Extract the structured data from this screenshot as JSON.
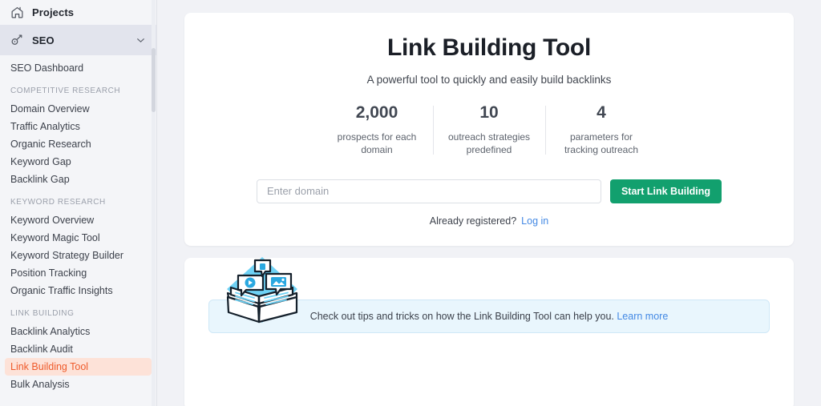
{
  "sidebar": {
    "projects": {
      "label": "Projects",
      "icon": "home-icon"
    },
    "seo": {
      "label": "SEO",
      "icon": "seo-magnifier-icon",
      "chevron": "chevron-down-icon"
    },
    "dashboard": {
      "label": "SEO Dashboard"
    },
    "sections": [
      {
        "title": "COMPETITIVE RESEARCH",
        "items": [
          {
            "label": "Domain Overview",
            "active": false
          },
          {
            "label": "Traffic Analytics",
            "active": false
          },
          {
            "label": "Organic Research",
            "active": false
          },
          {
            "label": "Keyword Gap",
            "active": false
          },
          {
            "label": "Backlink Gap",
            "active": false
          }
        ]
      },
      {
        "title": "KEYWORD RESEARCH",
        "items": [
          {
            "label": "Keyword Overview",
            "active": false
          },
          {
            "label": "Keyword Magic Tool",
            "active": false
          },
          {
            "label": "Keyword Strategy Builder",
            "active": false
          },
          {
            "label": "Position Tracking",
            "active": false
          },
          {
            "label": "Organic Traffic Insights",
            "active": false
          }
        ]
      },
      {
        "title": "LINK BUILDING",
        "items": [
          {
            "label": "Backlink Analytics",
            "active": false
          },
          {
            "label": "Backlink Audit",
            "active": false
          },
          {
            "label": "Link Building Tool",
            "active": true
          },
          {
            "label": "Bulk Analysis",
            "active": false
          }
        ]
      }
    ]
  },
  "hero": {
    "title": "Link Building Tool",
    "subtitle": "A powerful tool to quickly and easily build backlinks",
    "stats": [
      {
        "number": "2,000",
        "description": "prospects for each domain"
      },
      {
        "number": "10",
        "description": "outreach strategies predefined"
      },
      {
        "number": "4",
        "description": "parameters for tracking outreach"
      }
    ],
    "form": {
      "placeholder": "Enter domain",
      "value": "",
      "submit_label": "Start Link Building"
    },
    "registered_text": "Already registered?",
    "login_label": "Log in"
  },
  "banner": {
    "text": "Check out tips and tricks on how the Link Building Tool can help you.",
    "link_label": "Learn more",
    "illustration": "open-book-icon"
  },
  "colors": {
    "accent_green": "#12a06e",
    "active_orange": "#ef5b2b",
    "active_orange_bg": "#fde2d8",
    "link_blue": "#4489e4",
    "banner_blue_bg": "#e9f6fd",
    "page_bg": "#f1f2f6",
    "sidebar_bg": "#f4f5f8",
    "illustration_cyan": "#6fd2f5"
  }
}
